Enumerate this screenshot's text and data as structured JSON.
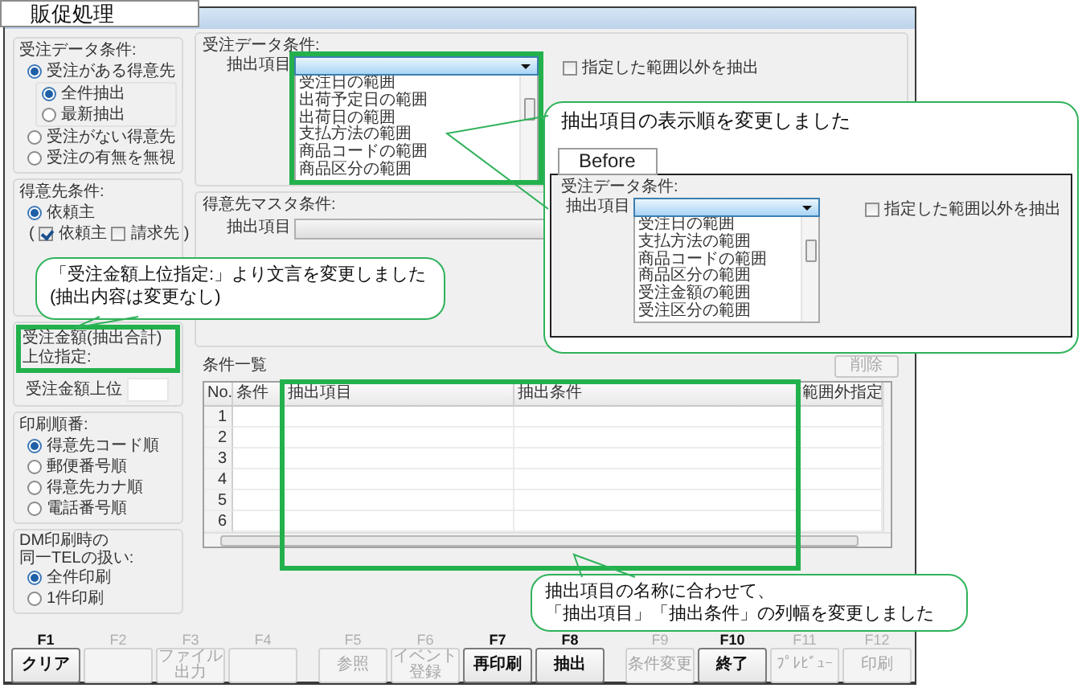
{
  "window": {
    "title": "販促処理"
  },
  "side_panel": {
    "order_data": {
      "label": "受注データ条件:",
      "options": [
        {
          "label": "受注がある得意先",
          "selected": true,
          "sub_options": [
            {
              "label": "全件抽出",
              "selected": true
            },
            {
              "label": "最新抽出",
              "selected": false
            }
          ]
        },
        {
          "label": "受注がない得意先",
          "selected": false
        },
        {
          "label": "受注の有無を無視",
          "selected": false
        }
      ]
    },
    "customer": {
      "label": "得意先条件:",
      "options": [
        {
          "label": "依頼主",
          "selected": true
        }
      ],
      "open": "(",
      "checkboxes": [
        {
          "label": "依頼主",
          "checked": true
        },
        {
          "label": "請求先",
          "checked": false
        }
      ],
      "close": ")"
    },
    "top_amount": {
      "label": "受注金額(抽出合計)上位指定:",
      "field_label": "受注金額上位"
    },
    "print_order": {
      "label": "印刷順番:",
      "options": [
        {
          "label": "得意先コード順",
          "selected": true
        },
        {
          "label": "郵便番号順",
          "selected": false
        },
        {
          "label": "得意先カナ順",
          "selected": false
        },
        {
          "label": "電話番号順",
          "selected": false
        }
      ]
    },
    "dm_tel": {
      "label_lines": [
        "DM印刷時の",
        "同一TELの扱い:"
      ],
      "options": [
        {
          "label": "全件印刷",
          "selected": true
        },
        {
          "label": "1件印刷",
          "selected": false
        }
      ]
    }
  },
  "order_conditions": {
    "label": "受注データ条件:",
    "field_label": "抽出項目",
    "items": [
      "受注日の範囲",
      "出荷予定日の範囲",
      "出荷日の範囲",
      "支払方法の範囲",
      "商品コードの範囲",
      "商品区分の範囲"
    ],
    "checkbox": {
      "label": "指定した範囲以外を抽出",
      "checked": false
    }
  },
  "customer_master": {
    "label": "得意先マスタ条件:",
    "field_label": "抽出項目"
  },
  "condition_list": {
    "label": "条件一覧",
    "delete_button": {
      "label": "削除",
      "disabled": true
    },
    "columns": [
      "No.",
      "条件",
      "抽出項目",
      "抽出条件",
      "範囲外指定"
    ],
    "rows": [
      "1",
      "2",
      "3",
      "4",
      "5",
      "6"
    ]
  },
  "function_keys": [
    {
      "key": "F1",
      "label": "クリア",
      "disabled": false
    },
    {
      "key": "F2",
      "disabled": true
    },
    {
      "key": "F3",
      "label": "ファイル出力",
      "disabled": true
    },
    {
      "key": "F4",
      "disabled": true
    },
    {
      "key": "F5",
      "label": "参照",
      "disabled": true
    },
    {
      "key": "F6",
      "label": "イベント登録",
      "disabled": true
    },
    {
      "key": "F7",
      "label": "再印刷",
      "disabled": false
    },
    {
      "key": "F8",
      "label": "抽出",
      "disabled": false
    },
    {
      "key": "F9",
      "label": "条件変更",
      "disabled": true
    },
    {
      "key": "F10",
      "label": "終了",
      "disabled": false
    },
    {
      "key": "F11",
      "label": "ﾌﾟﾚﾋﾞｭｰ",
      "disabled": true
    },
    {
      "key": "F12",
      "label": "印刷",
      "disabled": true
    }
  ],
  "callouts": [
    {
      "kind": "note",
      "lines": [
        "「受注金額上位指定:」より文言を変更しました",
        "(抽出内容は変更なし)"
      ]
    },
    {
      "kind": "before",
      "text": "抽出項目の表示順を変更しました",
      "tab": "Before",
      "inset": {
        "label": "受注データ条件:",
        "field_label": "抽出項目",
        "items": [
          "受注日の範囲",
          "支払方法の範囲",
          "商品コードの範囲",
          "商品区分の範囲",
          "受注金額の範囲",
          "受注区分の範囲"
        ],
        "checkbox": {
          "label": "指定した範囲以外を抽出",
          "checked": false
        }
      }
    },
    {
      "kind": "note",
      "lines": [
        "抽出項目の名称に合わせて、",
        "「抽出項目」「抽出条件」の列幅を変更しました"
      ]
    }
  ]
}
